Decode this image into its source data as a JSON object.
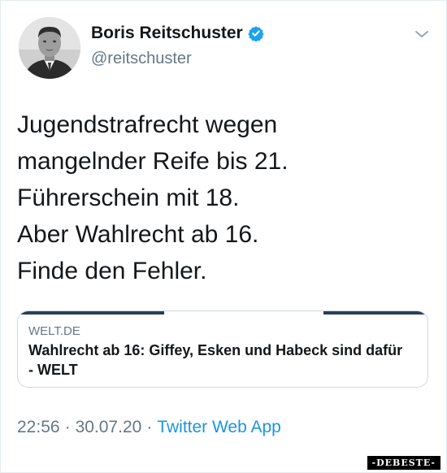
{
  "author": {
    "name": "Boris Reitschuster",
    "handle": "@reitschuster",
    "verified": true,
    "avatar_icon": "profile-photo"
  },
  "tweet": {
    "lines": [
      "Jugendstrafrecht wegen",
      "mangelnder Reife bis 21.",
      "Führerschein mit 18.",
      "Aber Wahlrecht ab 16.",
      "Finde den Fehler."
    ]
  },
  "link_card": {
    "domain": "WELT.DE",
    "title": "Wahlrecht ab 16: Giffey, Esken und Habeck sind dafür - WELT"
  },
  "meta": {
    "time": "22:56",
    "separator": "·",
    "date": "30.07.20",
    "source": "Twitter Web App"
  },
  "watermark": "-DEBESTE-",
  "colors": {
    "text": "#14171a",
    "secondary": "#657786",
    "link": "#1b95e0",
    "verified": "#1da1f2"
  }
}
